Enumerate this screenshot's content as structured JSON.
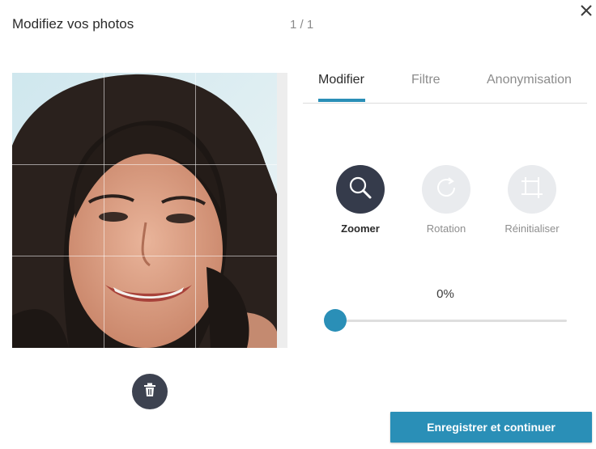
{
  "header": {
    "title": "Modifiez vos photos",
    "counter": "1 / 1",
    "close_icon": "close-icon"
  },
  "photo": {
    "alt": "photo-preview",
    "delete_icon": "trash-icon"
  },
  "tabs": [
    {
      "label": "Modifier",
      "active": true
    },
    {
      "label": "Filtre",
      "active": false
    },
    {
      "label": "Anonymisation",
      "active": false
    }
  ],
  "tools": [
    {
      "label": "Zoomer",
      "icon": "zoom-icon",
      "active": true
    },
    {
      "label": "Rotation",
      "icon": "rotate-icon",
      "active": false
    },
    {
      "label": "Réinitialiser",
      "icon": "crop-reset-icon",
      "active": false
    }
  ],
  "slider": {
    "value_label": "0%",
    "value": 0
  },
  "footer": {
    "save_label": "Enregistrer et continuer"
  },
  "colors": {
    "accent": "#2a8fb7",
    "tool_active": "#353b4b",
    "tool_inactive": "#e9ebee"
  }
}
